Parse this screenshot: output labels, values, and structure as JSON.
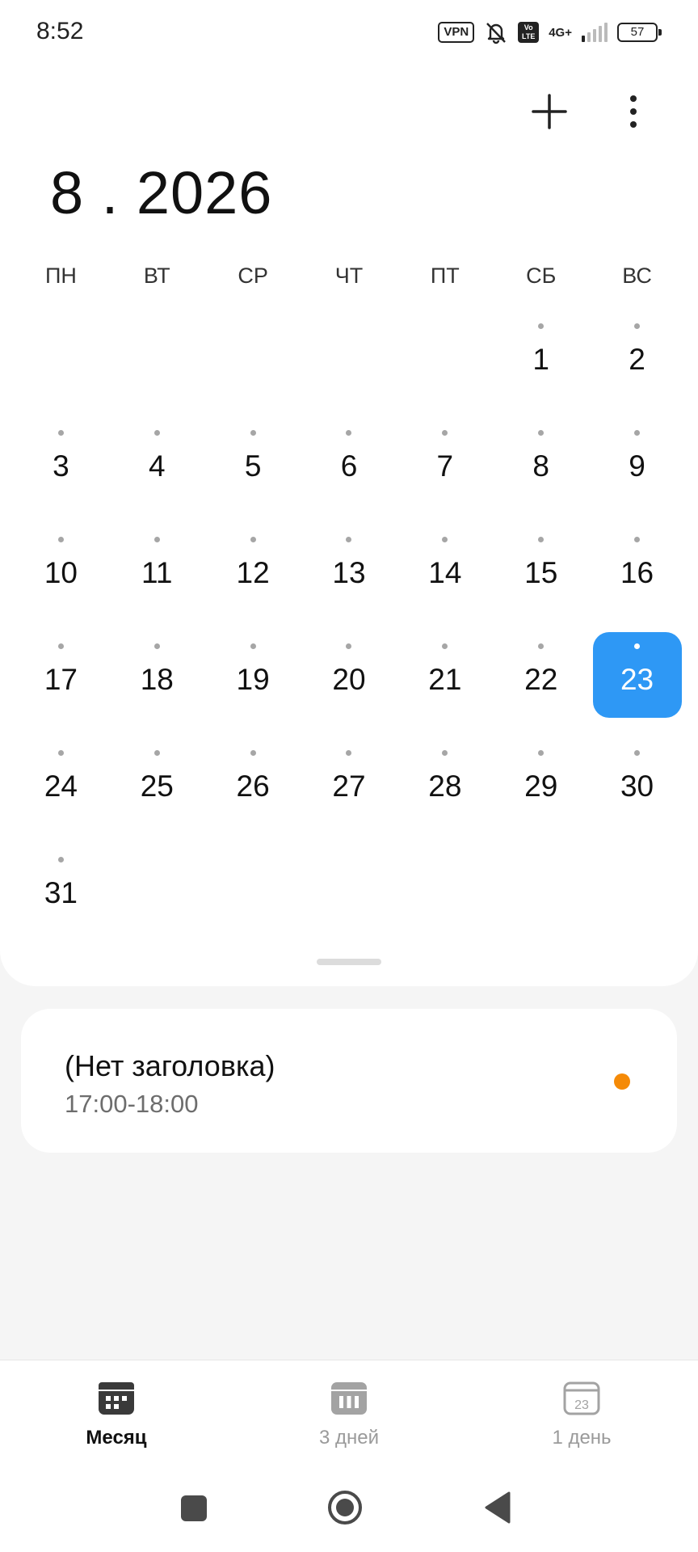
{
  "status_bar": {
    "time": "8:52",
    "vpn_label": "VPN",
    "volte_label": "Vo LTE",
    "network_label": "4G+",
    "battery_level": "57",
    "icons": [
      "vpn-icon",
      "bell-muted-icon",
      "volte-icon",
      "signal-icon",
      "battery-icon"
    ]
  },
  "header": {
    "month_title": "8 . 2026",
    "add_icon": "plus-icon",
    "more_icon": "more-vertical-icon"
  },
  "weekdays": [
    "ПН",
    "ВТ",
    "СР",
    "ЧТ",
    "ПТ",
    "СБ",
    "ВС"
  ],
  "calendar": {
    "leading_blanks": 5,
    "days": [
      "1",
      "2",
      "3",
      "4",
      "5",
      "6",
      "7",
      "8",
      "9",
      "10",
      "11",
      "12",
      "13",
      "14",
      "15",
      "16",
      "17",
      "18",
      "19",
      "20",
      "21",
      "22",
      "23",
      "24",
      "25",
      "26",
      "27",
      "28",
      "29",
      "30",
      "31"
    ],
    "selected_day": "23",
    "selected_color": "#2e98f5"
  },
  "event": {
    "title": "(Нет заголовка)",
    "time": "17:00-18:00",
    "color": "#f58a07"
  },
  "tabs": [
    {
      "label": "Месяц",
      "icon": "month-view-icon",
      "active": true
    },
    {
      "label": "3 дней",
      "icon": "three-day-view-icon",
      "active": false
    },
    {
      "label": "1 день",
      "icon": "day-view-icon",
      "active": false,
      "icon_text": "23"
    }
  ],
  "nav": {
    "icons": [
      "recent-apps-icon",
      "home-icon",
      "back-icon"
    ]
  }
}
